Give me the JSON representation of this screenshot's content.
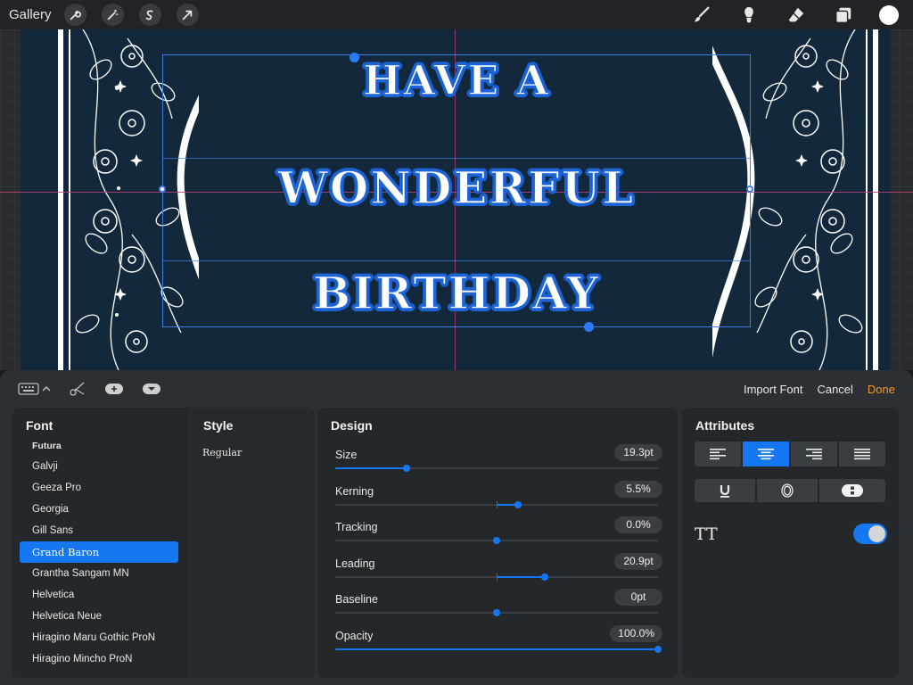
{
  "toolbar": {
    "gallery_label": "Gallery",
    "left_icons": [
      "wrench-icon",
      "magic-wand-icon",
      "selection-s-icon",
      "arrow-transform-icon"
    ],
    "right_tools": [
      "brush-icon",
      "smudge-icon",
      "eraser-icon",
      "layers-icon"
    ],
    "current_color": "#ffffff"
  },
  "canvas": {
    "lines": [
      "HAVE A",
      "WONDERFUL",
      "BIRTHDAY"
    ],
    "text_color": "#ffffff",
    "outline_color": "#1d64d6",
    "background_color": "#13283a"
  },
  "panel": {
    "import_font": "Import Font",
    "cancel": "Cancel",
    "done": "Done",
    "font": {
      "title": "Font",
      "items": [
        "Futura",
        "Galvji",
        "Geeza Pro",
        "Georgia",
        "Gill Sans",
        "Grand Baron",
        "Grantha Sangam MN",
        "Helvetica",
        "Helvetica Neue",
        "Hiragino Maru Gothic ProN",
        "Hiragino Mincho ProN"
      ],
      "selected": "Grand Baron"
    },
    "style": {
      "title": "Style",
      "items": [
        "Regular"
      ]
    },
    "design": {
      "title": "Design",
      "rows": [
        {
          "label": "Size",
          "value": "19.3pt",
          "fraction": 0.22,
          "centered": false,
          "highlighted": true
        },
        {
          "label": "Kerning",
          "value": "5.5%",
          "fraction": 0.065,
          "centered": true,
          "highlighted": true
        },
        {
          "label": "Tracking",
          "value": "0.0%",
          "fraction": 0.0,
          "centered": true,
          "highlighted": false
        },
        {
          "label": "Leading",
          "value": "20.9pt",
          "fraction": 0.15,
          "centered": true,
          "highlighted": true
        },
        {
          "label": "Baseline",
          "value": "0pt",
          "fraction": 0.0,
          "centered": true,
          "highlighted": false
        },
        {
          "label": "Opacity",
          "value": "100.0%",
          "fraction": 1.0,
          "centered": false,
          "highlighted": false
        }
      ]
    },
    "attributes": {
      "title": "Attributes",
      "alignments": [
        "align-left-icon",
        "align-center-icon",
        "align-right-icon",
        "align-justify-icon"
      ],
      "active_alignment": "align-center-icon",
      "formats": [
        "underline-icon",
        "outline-icon",
        "vertical-text-icon"
      ],
      "all_caps_label": "TT",
      "all_caps_on": true
    }
  }
}
